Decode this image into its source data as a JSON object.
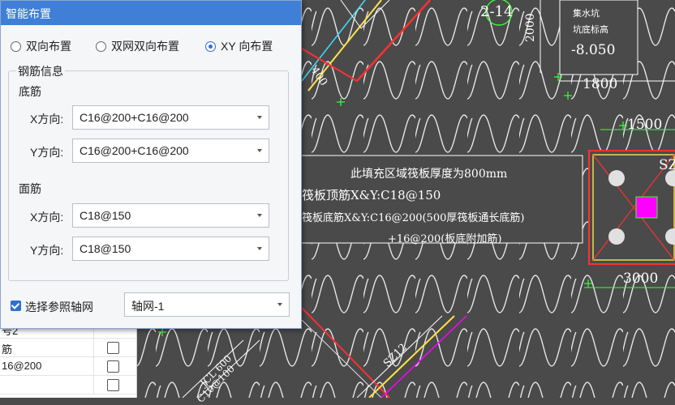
{
  "dialog": {
    "title": "智能布置",
    "modes": [
      {
        "label": "双向布置",
        "selected": false
      },
      {
        "label": "双网双向布置",
        "selected": false
      },
      {
        "label": "XY 向布置",
        "selected": true
      }
    ],
    "group_title": "钢筋信息",
    "bottom": {
      "title": "底筋",
      "x_label": "X方向:",
      "x_value": "C16@200+C16@200",
      "y_label": "Y方向:",
      "y_value": "C16@200+C16@200"
    },
    "top": {
      "title": "面筋",
      "x_label": "X方向:",
      "x_value": "C18@150",
      "y_label": "Y方向:",
      "y_value": "C18@150"
    },
    "ref_grid": {
      "checked": true,
      "label": "选择参照轴网",
      "value": "轴网-1"
    }
  },
  "background_table": {
    "rows": [
      "号2",
      "筋",
      "16@200",
      ""
    ]
  },
  "cad": {
    "grid_label": "2-14",
    "note_title": "集水坑",
    "note_sub": "坑底标高",
    "elevation": "-8.050",
    "dim_2000": "2000",
    "dim_1800": "1800",
    "dim_1500": "1500",
    "dim_3000": "3000",
    "dim_400": "400",
    "col_label": "SZ",
    "slab_line1": "此填充区域筏板厚度为800mm",
    "slab_line2": "筏板顶筋X&Y:C18@150",
    "slab_line3": "筏板底筋X&Y:C16@200(500厚筏板通长底筋)",
    "slab_line4": "+16@200(板底附加筋)",
    "beam_label": "SZ12",
    "jcl_label": "JCL 600",
    "jcl_sub": "C10@100"
  },
  "colors": {
    "title_bar": "#3f7fd6",
    "accent": "#2f6ed1",
    "cad_bg": "#4a4a4a",
    "cad_red": "#ff3030",
    "cad_magenta": "#ff00ff",
    "cad_yellow": "#ffe24a",
    "cad_cyan": "#40e0ff",
    "cad_green": "#3cff3c"
  }
}
